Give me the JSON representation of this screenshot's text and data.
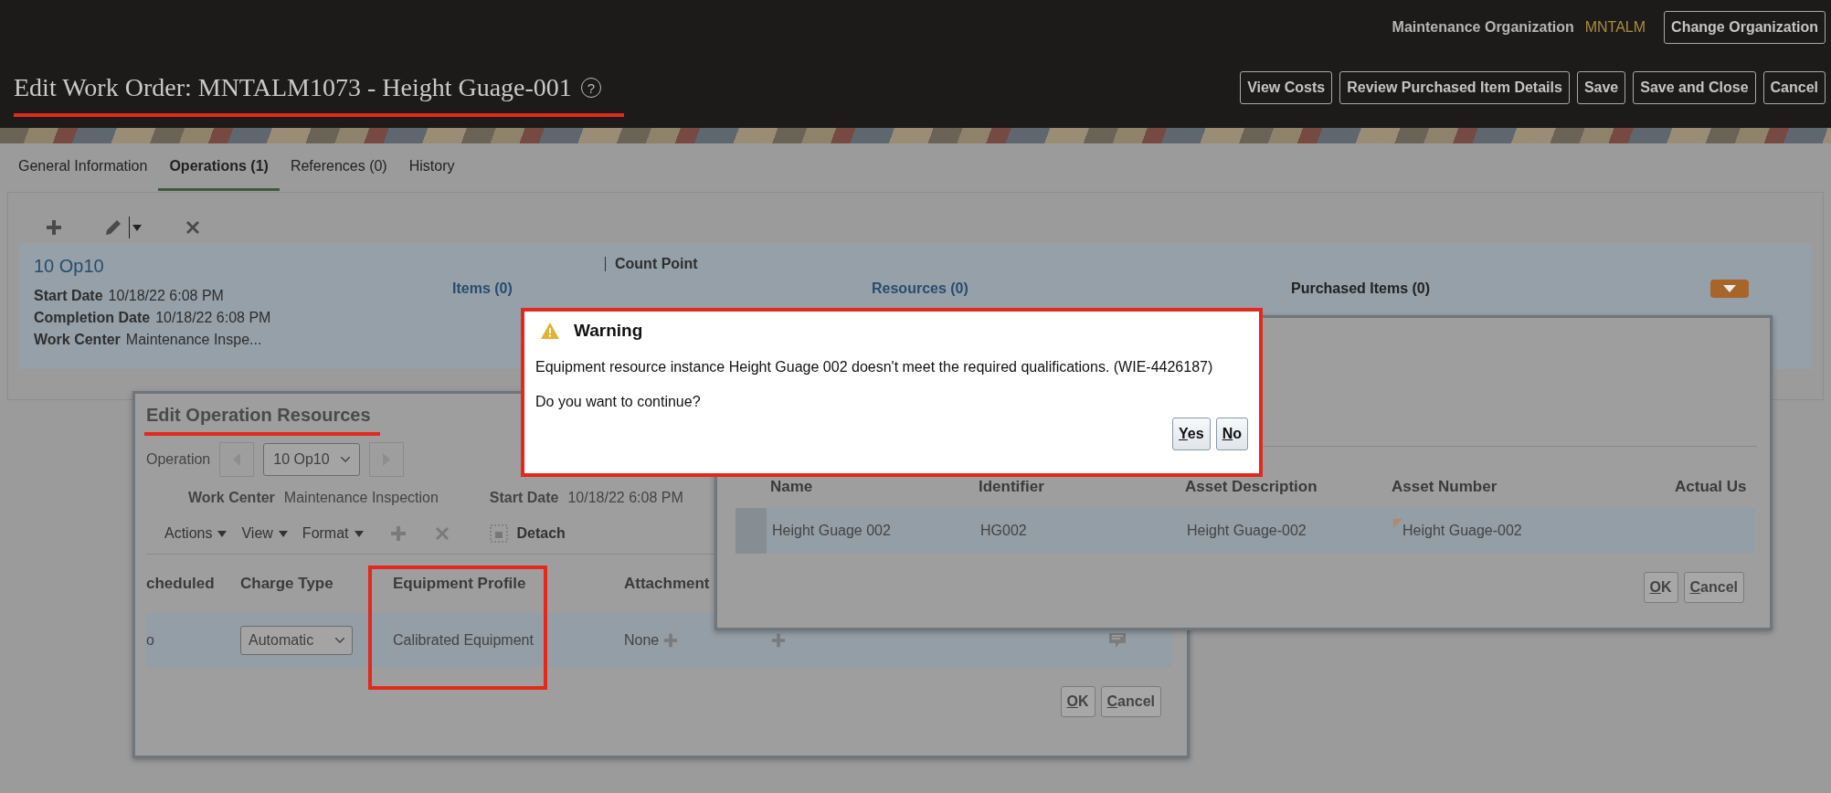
{
  "header": {
    "org_label": "Maintenance Organization",
    "org_value": "MNTALM",
    "change_org_button": "Change Organization",
    "title": "Edit Work Order: MNTALM1073 - Height Guage-001",
    "help_icon": "?",
    "buttons": [
      "View Costs",
      "Review Purchased Item Details",
      "Save",
      "Save and Close",
      "Cancel"
    ]
  },
  "tabs": [
    {
      "label": "General Information",
      "selected": false
    },
    {
      "label": "Operations (1)",
      "selected": true
    },
    {
      "label": "References (0)",
      "selected": false
    },
    {
      "label": "History",
      "selected": false
    }
  ],
  "operation": {
    "name": "10 Op10",
    "count_point": "Count Point",
    "fields": [
      {
        "label": "Start Date",
        "value": "10/18/22 6:08 PM"
      },
      {
        "label": "Completion Date",
        "value": "10/18/22 6:08 PM"
      },
      {
        "label": "Work Center",
        "value": "Maintenance Inspe..."
      }
    ],
    "links": [
      "Items (0)",
      "Resources (0)",
      "Purchased Items (0)"
    ]
  },
  "edit_resources_dialog": {
    "title": "Edit Operation Resources",
    "operation_label": "Operation",
    "operation_value": "10 Op10",
    "work_center_label": "Work Center",
    "work_center_value": "Maintenance Inspection",
    "start_date_label": "Start Date",
    "start_date_value": "10/18/22 6:08 PM",
    "menus": [
      "Actions",
      "View",
      "Format"
    ],
    "detach": "Detach",
    "columns": [
      "cheduled",
      "Charge Type",
      "Equipment Profile",
      "Attachment"
    ],
    "row": {
      "scheduled": "o",
      "charge_type": "Automatic",
      "equipment_profile": "Calibrated Equipment",
      "attachments": "None"
    },
    "buttons": [
      "OK",
      "Cancel"
    ]
  },
  "instances_dialog": {
    "columns": [
      "Name",
      "Identifier",
      "Asset Description",
      "Asset Number",
      "Actual Us"
    ],
    "rows": [
      {
        "name": "Height Guage 002",
        "identifier": "HG002",
        "asset_description": "Height Guage-002",
        "asset_number": "Height Guage-002"
      }
    ],
    "buttons": [
      "OK",
      "Cancel"
    ]
  },
  "warning": {
    "title": "Warning",
    "message": "Equipment resource instance Height Guage 002 doesn't meet the required qualifications. (WIE-4426187)",
    "question": "Do you want to continue?",
    "buttons": [
      "Yes",
      "No"
    ]
  }
}
